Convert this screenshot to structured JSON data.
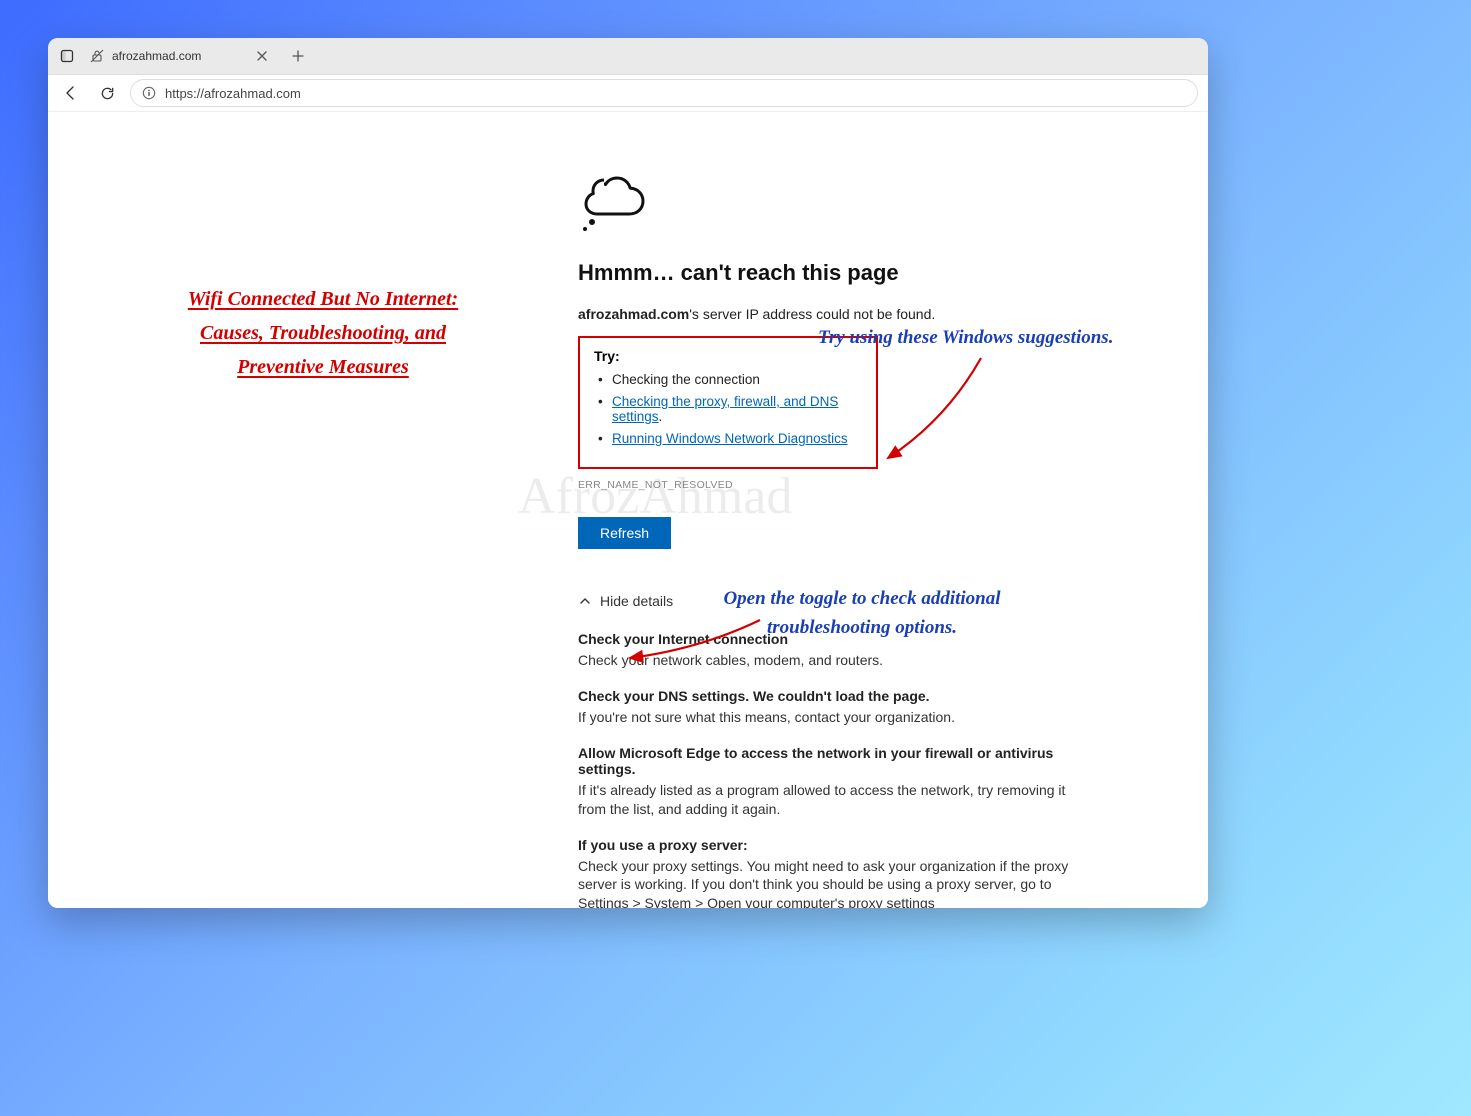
{
  "tab": {
    "title": "afrozahmad.com"
  },
  "url": "https://afrozahmad.com",
  "error": {
    "heading": "Hmmm… can't reach this page",
    "domain": "afrozahmad.com",
    "sub_suffix": "'s server IP address could not be found.",
    "try_label": "Try:",
    "try_items": {
      "t0": "Checking the connection",
      "t1": "Checking the proxy, firewall, and DNS settings",
      "t2": "Running Windows Network Diagnostics"
    },
    "code": "ERR_NAME_NOT_RESOLVED",
    "refresh": "Refresh",
    "hide": "Hide details"
  },
  "details": {
    "s0h": "Check your Internet connection",
    "s0b": "Check your network cables, modem, and routers.",
    "s1h": "Check your DNS settings. We couldn't load the page.",
    "s1b": "If you're not sure what this means, contact your organization.",
    "s2h": "Allow Microsoft Edge to access the network in your firewall or antivirus settings.",
    "s2b": "If it's already listed as a program allowed to access the network, try removing it from the list, and adding it again.",
    "s3h": "If you use a proxy server:",
    "s3b": "Check your proxy settings. You might need to ask your organization if the proxy server is working. If you don't think you should be using a proxy server, go to Settings > System > Open your computer's proxy settings"
  },
  "watermark": "AfrozAhmad",
  "annotations": {
    "title_l1": "Wifi Connected But No Internet:",
    "title_l2": "Causes, Troubleshooting, and",
    "title_l3": "Preventive Measures",
    "suggestions": "Try using these Windows suggestions.",
    "toggle_l1": "Open the toggle to check additional",
    "toggle_l2": "troubleshooting options."
  }
}
